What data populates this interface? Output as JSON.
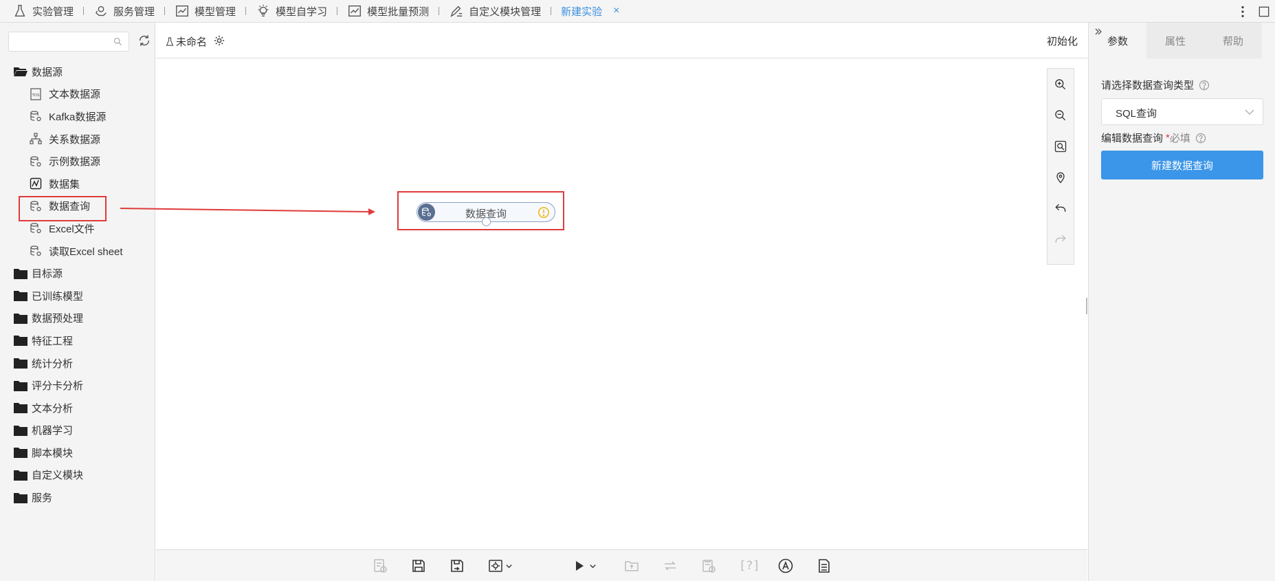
{
  "topnav": {
    "tabs": [
      {
        "label": "实验管理",
        "icon": "flask-icon"
      },
      {
        "label": "服务管理",
        "icon": "service-icon"
      },
      {
        "label": "模型管理",
        "icon": "chart-icon"
      },
      {
        "label": "模型自学习",
        "icon": "lightbulb-icon"
      },
      {
        "label": "模型批量预测",
        "icon": "chart-icon"
      },
      {
        "label": "自定义模块管理",
        "icon": "edit-list-icon"
      },
      {
        "label": "新建实验",
        "icon": "",
        "active": true
      }
    ],
    "close_symbol": "×",
    "accent": "#3b8fe0"
  },
  "sidebar": {
    "search_placeholder": "",
    "tree": [
      {
        "label": "数据源",
        "type": "folder",
        "open": true,
        "children": [
          {
            "label": "文本数据源",
            "icon": "tds-file-icon"
          },
          {
            "label": "Kafka数据源",
            "icon": "database-gear-icon"
          },
          {
            "label": "关系数据源",
            "icon": "relation-icon"
          },
          {
            "label": "示例数据源",
            "icon": "database-gear-icon"
          },
          {
            "label": "数据集",
            "icon": "dataset-icon"
          },
          {
            "label": "数据查询",
            "icon": "database-gear-icon",
            "highlighted": true
          },
          {
            "label": "Excel文件",
            "icon": "database-gear-icon"
          },
          {
            "label": "读取Excel sheet",
            "icon": "database-gear-icon"
          }
        ]
      },
      {
        "label": "目标源",
        "type": "folder"
      },
      {
        "label": "已训练模型",
        "type": "folder"
      },
      {
        "label": "数据预处理",
        "type": "folder"
      },
      {
        "label": "特征工程",
        "type": "folder"
      },
      {
        "label": "统计分析",
        "type": "folder"
      },
      {
        "label": "评分卡分析",
        "type": "folder"
      },
      {
        "label": "文本分析",
        "type": "folder"
      },
      {
        "label": "机器学习",
        "type": "folder"
      },
      {
        "label": "脚本模块",
        "type": "folder"
      },
      {
        "label": "自定义模块",
        "type": "folder"
      },
      {
        "label": "服务",
        "type": "folder"
      }
    ]
  },
  "canvas": {
    "experiment_name": "未命名",
    "init_label": "初始化",
    "node": {
      "label": "数据查询",
      "status": "warning"
    }
  },
  "right_panel": {
    "tabs": [
      "参数",
      "属性",
      "帮助"
    ],
    "active_tab": "参数",
    "query_type_label": "请选择数据查询类型",
    "query_type_value": "SQL查询",
    "edit_query_label": "编辑数据查询",
    "required_mark": "*",
    "required_text": "必填",
    "new_query_button": "新建数据查询",
    "button_color": "#3b95e8"
  }
}
